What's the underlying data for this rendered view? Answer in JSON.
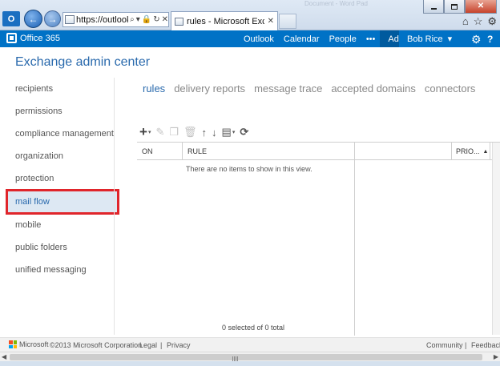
{
  "browser": {
    "address": "https://outlook.",
    "tab_title": "rules - Microsoft Exchange",
    "ghost_title": "Document - Word Pad"
  },
  "o365": {
    "logo": "Office 365",
    "nav": [
      "Outlook",
      "Calendar",
      "People",
      "•••",
      "Admin"
    ],
    "user": "Bob Rice"
  },
  "app": {
    "title": "Exchange admin center"
  },
  "sidebar": {
    "items": [
      {
        "label": "recipients"
      },
      {
        "label": "permissions"
      },
      {
        "label": "compliance management"
      },
      {
        "label": "organization"
      },
      {
        "label": "protection"
      },
      {
        "label": "mail flow"
      },
      {
        "label": "mobile"
      },
      {
        "label": "public folders"
      },
      {
        "label": "unified messaging"
      }
    ],
    "active": "mail flow"
  },
  "tabs": [
    "rules",
    "delivery reports",
    "message trace",
    "accepted domains",
    "connectors"
  ],
  "active_tab": "rules",
  "grid": {
    "columns": [
      "ON",
      "RULE",
      "PRIO..."
    ],
    "empty_message": "There are no items to show in this view.",
    "count": "0 selected of 0 total"
  },
  "footer": {
    "brand": "Microsoft",
    "copyright": "©2013 Microsoft Corporation",
    "legal": "Legal",
    "separator": "|",
    "privacy": "Privacy",
    "community": "Community",
    "feedback": "Feedback"
  },
  "colors": {
    "o365_bar": "#0072c6",
    "accent_text": "#2a6aad",
    "highlight_outline": "#e0252b"
  }
}
